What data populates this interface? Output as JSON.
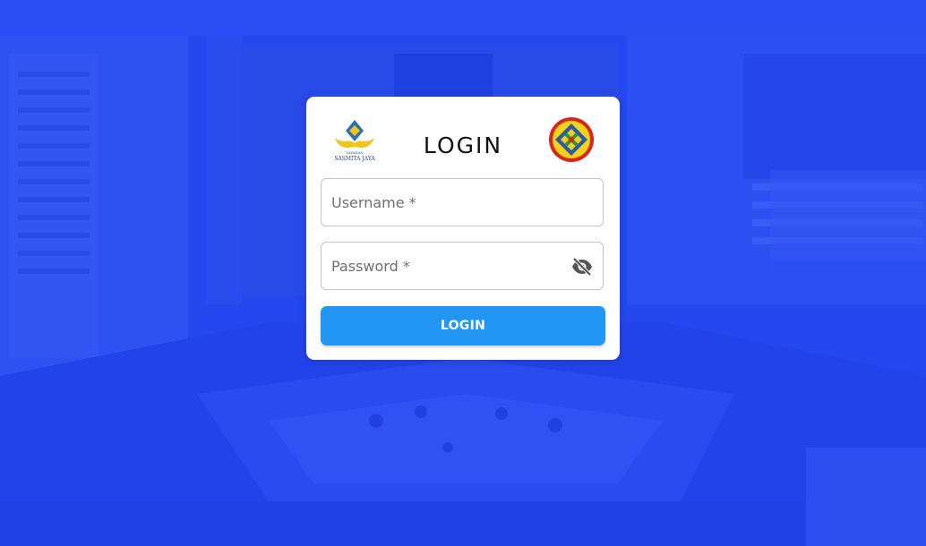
{
  "page": {
    "title": "LOGIN"
  },
  "logos": {
    "left": {
      "small_text": "YAYASAN",
      "name": "SASMITA JAYA",
      "icon": "sasmita-jaya-logo-icon"
    },
    "right": {
      "icon": "university-seal-icon"
    }
  },
  "form": {
    "username": {
      "value": "",
      "placeholder": "Username *"
    },
    "password": {
      "value": "",
      "placeholder": "Password *",
      "toggle_icon": "eye-off-icon"
    },
    "submit_label": "LOGIN"
  },
  "colors": {
    "background": "#2447f0",
    "card": "#ffffff",
    "button": "#2196f3",
    "button_text": "#ffffff"
  }
}
